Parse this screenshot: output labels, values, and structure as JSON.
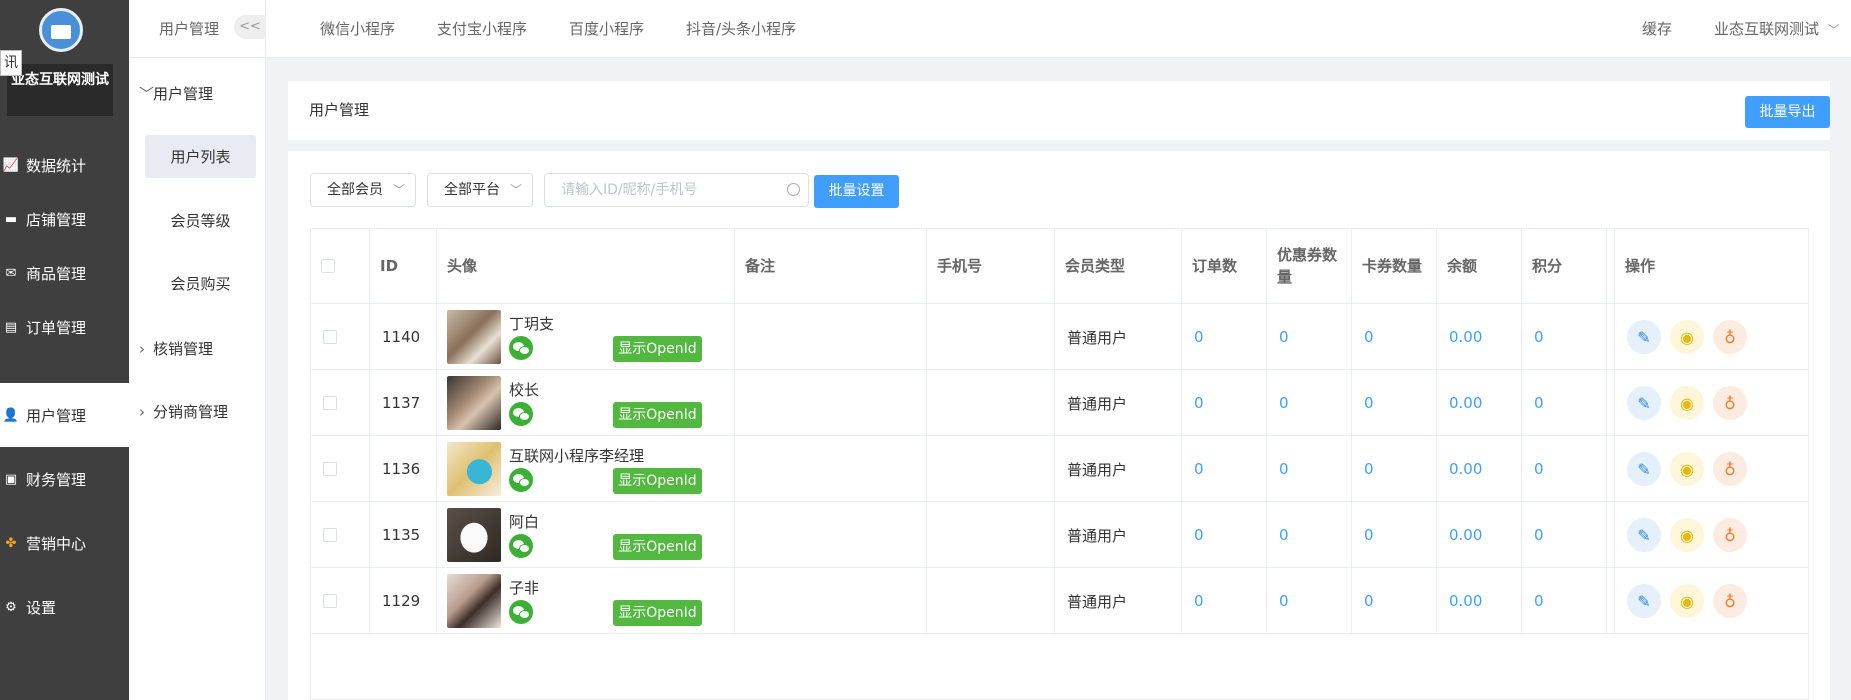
{
  "brand": {
    "name": "业态互联网测试",
    "float_char": "讯"
  },
  "main_menu": [
    {
      "label": "数据统计",
      "icon": "chart-line-icon"
    },
    {
      "label": "店铺管理",
      "icon": "store-icon"
    },
    {
      "label": "商品管理",
      "icon": "goods-icon"
    },
    {
      "label": "订单管理",
      "icon": "order-icon"
    },
    {
      "label": "用户管理",
      "icon": "user-icon",
      "active": true
    },
    {
      "label": "财务管理",
      "icon": "finance-icon"
    },
    {
      "label": "营销中心",
      "icon": "marketing-icon"
    },
    {
      "label": "设置",
      "icon": "settings-icon"
    }
  ],
  "sub_menu": {
    "title": "用户管理",
    "collapse_label": "<<",
    "group1": "用户管理",
    "items": [
      "用户列表",
      "会员等级",
      "会员购买"
    ],
    "group2": "核销管理",
    "group3": "分销商管理"
  },
  "top_tabs": [
    "微信小程序",
    "支付宝小程序",
    "百度小程序",
    "抖音/头条小程序"
  ],
  "top_right": {
    "cache": "缓存",
    "account": "业态互联网测试"
  },
  "page": {
    "title": "用户管理",
    "export_button": "批量导出"
  },
  "filters": {
    "member_select": "全部会员",
    "platform_select": "全部平台",
    "search_placeholder": "请输入ID/昵称/手机号",
    "batch_button": "批量设置"
  },
  "table": {
    "headers": {
      "id": "ID",
      "avatar": "头像",
      "remark": "备注",
      "phone": "手机号",
      "member_type": "会员类型",
      "orders": "订单数",
      "coupons": "优惠券数量",
      "cards": "卡券数量",
      "balance": "余额",
      "points": "积分",
      "ops": "操作"
    },
    "openid_label": "显示OpenId",
    "rows": [
      {
        "id": "1140",
        "name": "丁玥支",
        "member_type": "普通用户",
        "orders": "0",
        "coupons": "0",
        "cards": "0",
        "balance": "0.00",
        "points": "0"
      },
      {
        "id": "1137",
        "name": "校长",
        "member_type": "普通用户",
        "orders": "0",
        "coupons": "0",
        "cards": "0",
        "balance": "0.00",
        "points": "0"
      },
      {
        "id": "1136",
        "name": "互联网小程序李经理",
        "member_type": "普通用户",
        "orders": "0",
        "coupons": "0",
        "cards": "0",
        "balance": "0.00",
        "points": "0"
      },
      {
        "id": "1135",
        "name": "阿白",
        "member_type": "普通用户",
        "orders": "0",
        "coupons": "0",
        "cards": "0",
        "balance": "0.00",
        "points": "0"
      },
      {
        "id": "1129",
        "name": "子非",
        "member_type": "普通用户",
        "orders": "0",
        "coupons": "0",
        "cards": "0",
        "balance": "0.00",
        "points": "0"
      }
    ]
  },
  "colors": {
    "sidebar": "#3f3f3f",
    "primary": "#409eff",
    "openid_green": "#52b840",
    "wechat_green": "#3cb034"
  }
}
